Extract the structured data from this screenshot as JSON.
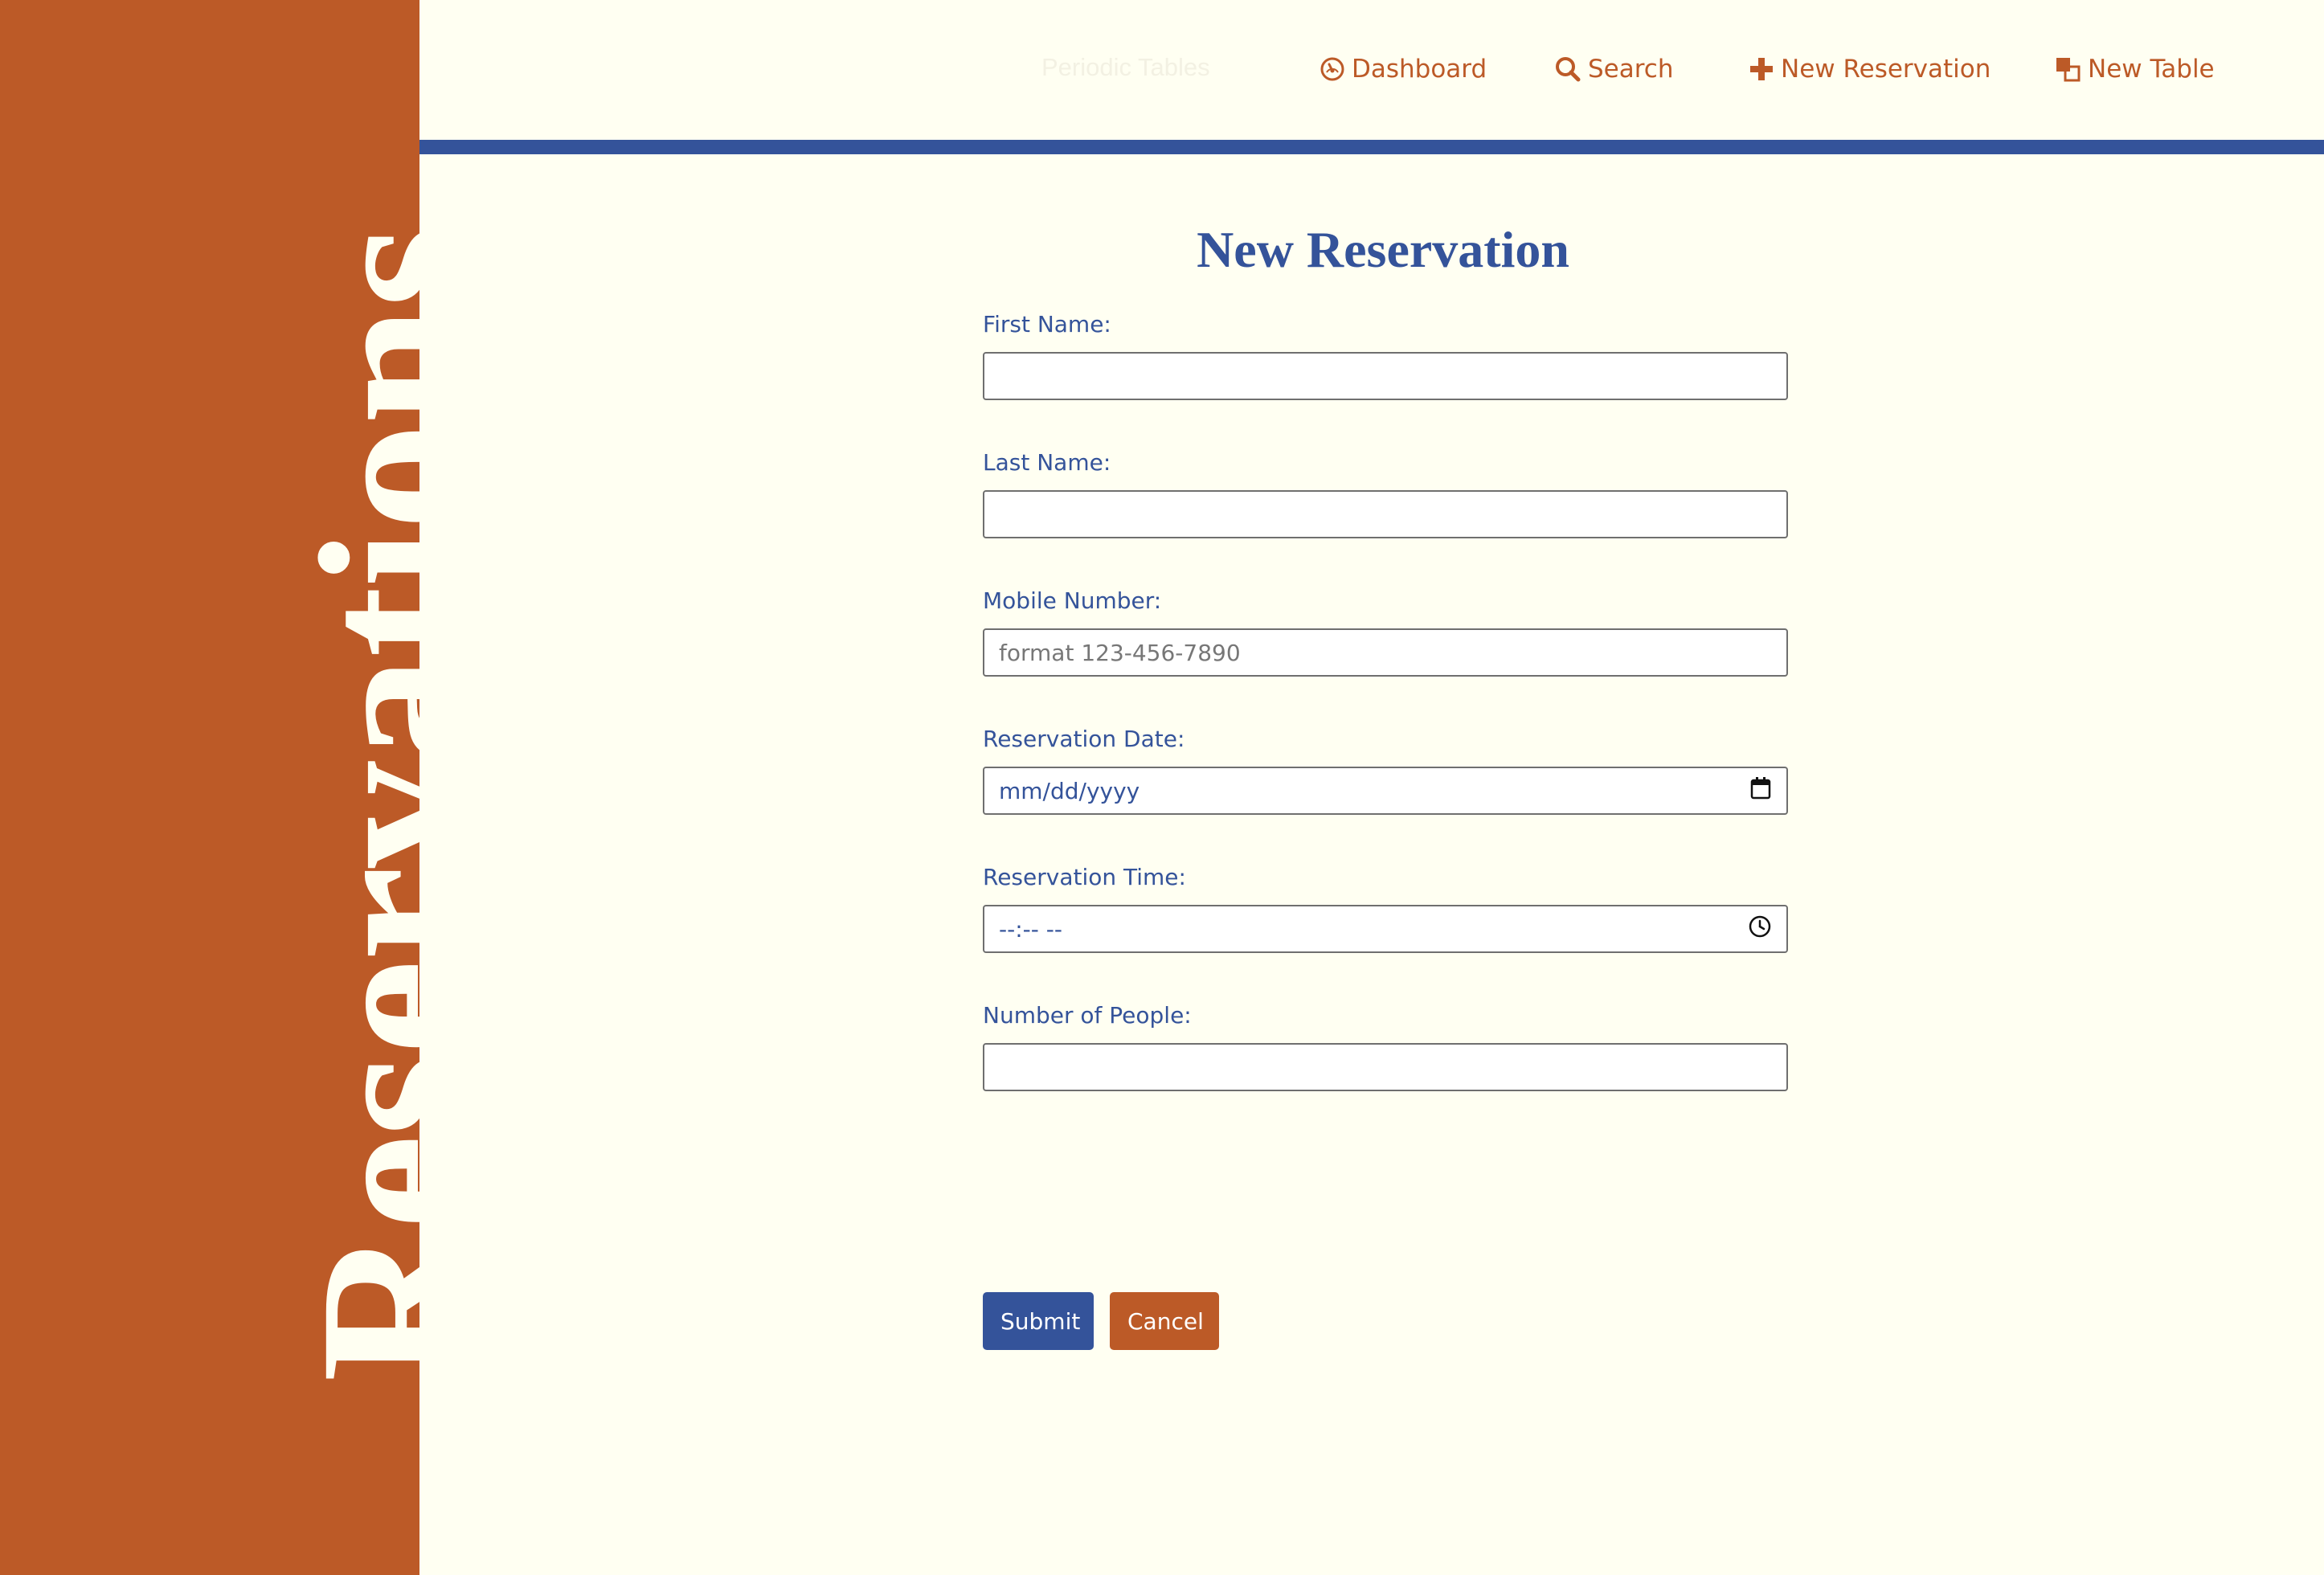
{
  "sidebar": {
    "title": "Reservations"
  },
  "nav": {
    "faint_text": "Periodic Tables",
    "items": [
      {
        "label": "Dashboard",
        "icon": "dashboard-icon"
      },
      {
        "label": "Search",
        "icon": "search-icon"
      },
      {
        "label": "New Reservation",
        "icon": "plus-icon"
      },
      {
        "label": "New Table",
        "icon": "layers-icon"
      }
    ]
  },
  "page": {
    "title": "New Reservation"
  },
  "form": {
    "first_name": {
      "label": "First Name:",
      "value": "",
      "placeholder": ""
    },
    "last_name": {
      "label": "Last Name:",
      "value": "",
      "placeholder": ""
    },
    "mobile_number": {
      "label": "Mobile Number:",
      "value": "",
      "placeholder": "format 123-456-7890"
    },
    "reservation_date": {
      "label": "Reservation Date:",
      "value": "mm/dd/yyyy",
      "icon": "calendar-icon"
    },
    "reservation_time": {
      "label": "Reservation Time:",
      "value": "--:-- --",
      "icon": "clock-icon"
    },
    "people": {
      "label": "Number of People:",
      "value": "",
      "placeholder": ""
    },
    "submit_label": "Submit",
    "cancel_label": "Cancel"
  },
  "colors": {
    "sidebar_bg": "#bc5a27",
    "accent_blue": "#34539a",
    "page_bg": "#fffff2",
    "nav_text": "#bc5a27"
  }
}
